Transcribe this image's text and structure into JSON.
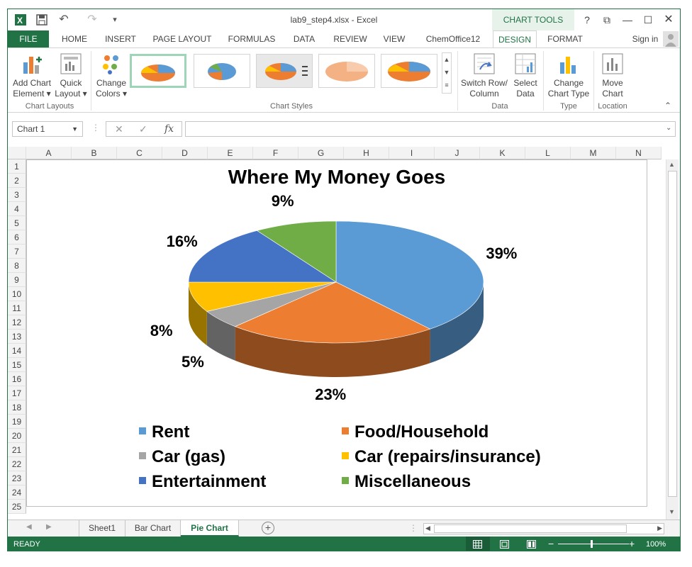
{
  "window": {
    "title": "lab9_step4.xlsx - Excel",
    "chart_tools": "CHART TOOLS",
    "help": "?",
    "sign_in": "Sign in"
  },
  "tabs": [
    "FILE",
    "HOME",
    "INSERT",
    "PAGE LAYOUT",
    "FORMULAS",
    "DATA",
    "REVIEW",
    "VIEW",
    "ChemOffice12",
    "DESIGN",
    "FORMAT"
  ],
  "ribbon": {
    "add_chart_element": [
      "Add Chart",
      "Element"
    ],
    "quick_layout": [
      "Quick",
      "Layout"
    ],
    "change_colors": [
      "Change",
      "Colors"
    ],
    "switch_row_column": [
      "Switch Row/",
      "Column"
    ],
    "select_data": [
      "Select",
      "Data"
    ],
    "change_chart_type": [
      "Change",
      "Chart Type"
    ],
    "move_chart": [
      "Move",
      "Chart"
    ],
    "groups": {
      "chart_layouts": "Chart Layouts",
      "chart_styles": "Chart Styles",
      "data": "Data",
      "type": "Type",
      "location": "Location"
    }
  },
  "formula_bar": {
    "name_box": "Chart 1",
    "fx": "fx",
    "value": ""
  },
  "columns": [
    "A",
    "B",
    "C",
    "D",
    "E",
    "F",
    "G",
    "H",
    "I",
    "J",
    "K",
    "L",
    "M",
    "N"
  ],
  "rows": [
    "1",
    "2",
    "3",
    "4",
    "5",
    "6",
    "7",
    "8",
    "9",
    "10",
    "11",
    "12",
    "13",
    "14",
    "15",
    "16",
    "17",
    "18",
    "19",
    "20",
    "21",
    "22",
    "23",
    "24",
    "25"
  ],
  "chart_data": {
    "type": "pie",
    "title": "Where My Money Goes",
    "categories": [
      "Rent",
      "Food/Household",
      "Car (gas)",
      "Car (repairs/insurance)",
      "Entertainment",
      "Miscellaneous"
    ],
    "values": [
      39,
      23,
      5,
      8,
      16,
      9
    ],
    "labels": [
      "39%",
      "23%",
      "5%",
      "8%",
      "16%",
      "9%"
    ],
    "colors": [
      "#5b9bd5",
      "#ed7d31",
      "#a5a5a5",
      "#ffc000",
      "#4472c4",
      "#70ad47"
    ],
    "legend_position": "bottom",
    "style": "3-D pie"
  },
  "sheets": [
    "Sheet1",
    "Bar Chart",
    "Pie Chart"
  ],
  "active_sheet": "Pie Chart",
  "status": {
    "mode": "READY",
    "zoom": "100%"
  }
}
